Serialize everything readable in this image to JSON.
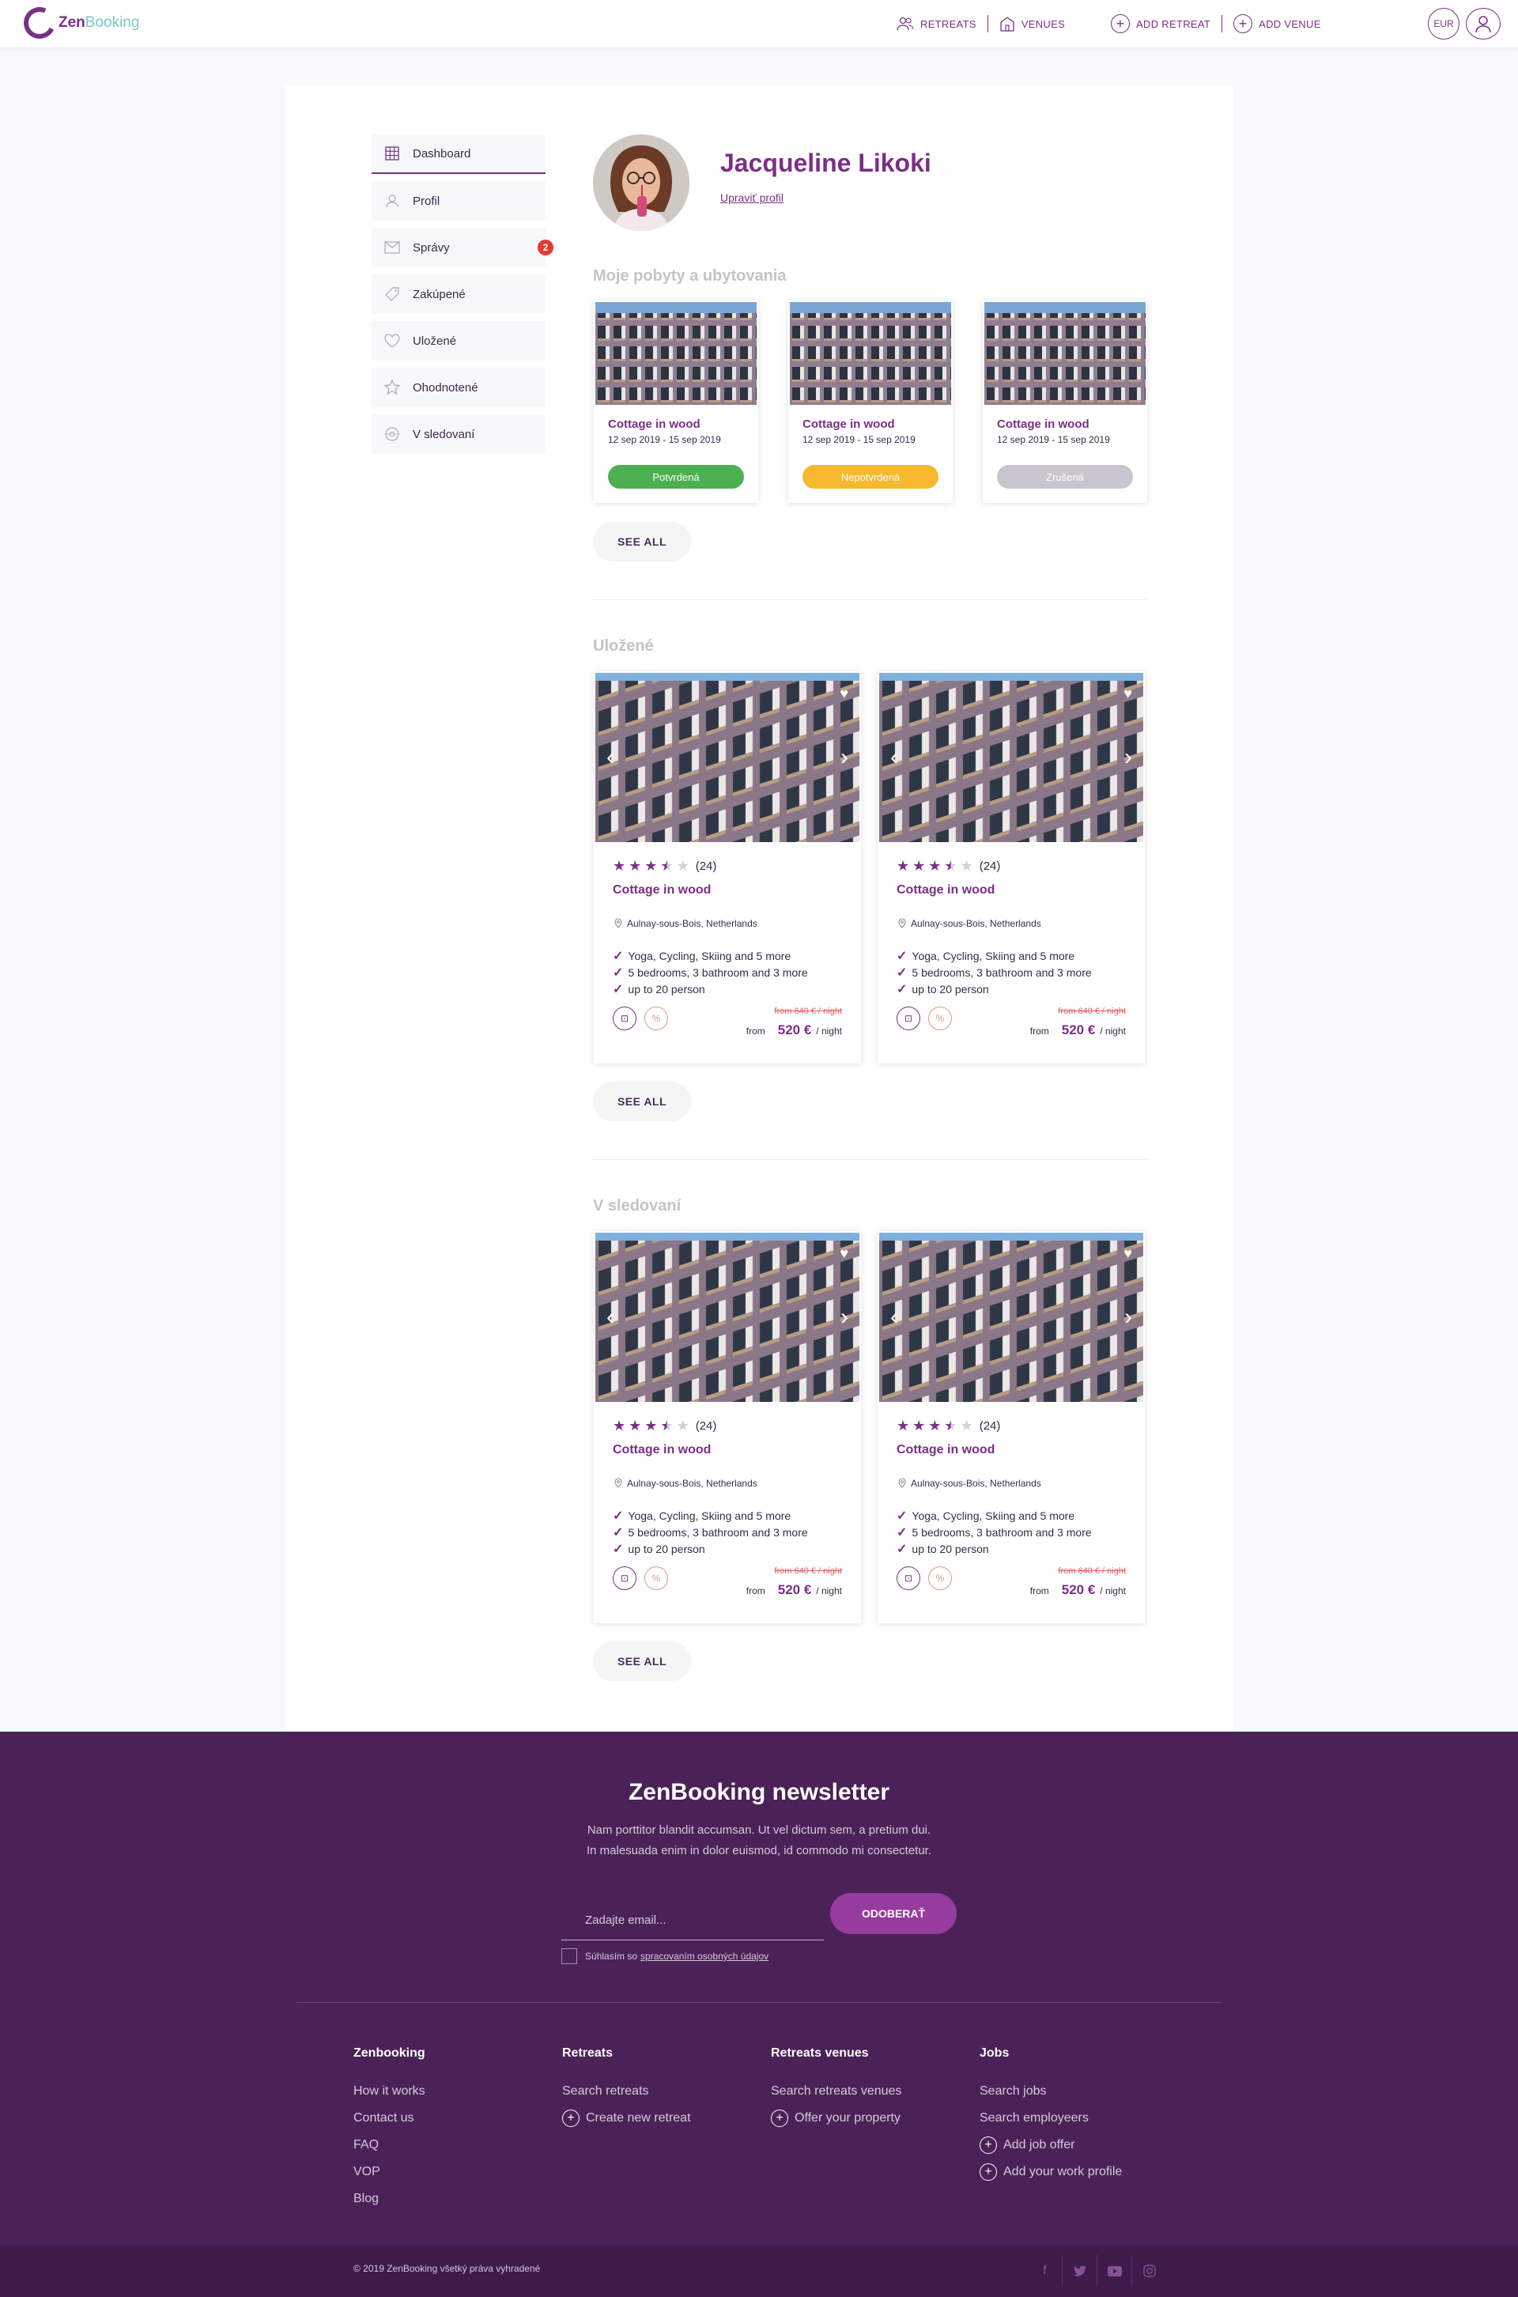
{
  "header": {
    "logo": {
      "part1": "Zen",
      "part2": "Booking"
    },
    "nav": {
      "retreats": "RETREATS",
      "venues": "VENUES",
      "add_retreat": "ADD RETREAT",
      "add_venue": "ADD VENUE"
    },
    "currency": "EUR"
  },
  "sidebar": {
    "items": [
      {
        "label": "Dashboard",
        "icon": "grid-icon"
      },
      {
        "label": "Profil",
        "icon": "user-icon"
      },
      {
        "label": "Správy",
        "icon": "envelope-icon",
        "badge": "2"
      },
      {
        "label": "Zakúpené",
        "icon": "tag-icon"
      },
      {
        "label": "Uložené",
        "icon": "heart-icon"
      },
      {
        "label": "Ohodnotené",
        "icon": "star-icon"
      },
      {
        "label": "V sledovaní",
        "icon": "eye-icon"
      }
    ]
  },
  "profile": {
    "name": "Jacqueline Likoki",
    "edit": "Upraviť profil"
  },
  "stays": {
    "title": "Moje pobyty a ubytovania",
    "cards": [
      {
        "name": "Cottage in wood",
        "dates": "12 sep 2019 - 15 sep 2019",
        "status": "Potvrdená",
        "status_color": "#4caf50"
      },
      {
        "name": "Cottage in wood",
        "dates": "12 sep 2019 - 15 sep 2019",
        "status": "Nepotvrdená",
        "status_color": "#f5b82e"
      },
      {
        "name": "Cottage in wood",
        "dates": "12 sep 2019 - 15 sep 2019",
        "status": "Zrušená",
        "status_color": "#c9c5cf"
      }
    ],
    "see_all": "SEE ALL"
  },
  "saved": {
    "title": "Uložené",
    "see_all": "SEE ALL",
    "cards": [
      {
        "rating": 3.5,
        "reviews": "(24)",
        "name": "Cottage in wood",
        "location": "Aulnay-sous-Bois, Netherlands",
        "features": [
          "Yoga, Cycling, Skiing and 5 more",
          "5 bedrooms, 3 bathroom and 3 more",
          "up to 20 person"
        ],
        "old_price": "from 640 € / night",
        "price_from": "from",
        "price": "520 €",
        "price_unit": "/ night"
      },
      {
        "rating": 3.5,
        "reviews": "(24)",
        "name": "Cottage in wood",
        "location": "Aulnay-sous-Bois, Netherlands",
        "features": [
          "Yoga, Cycling, Skiing and 5 more",
          "5 bedrooms, 3 bathroom and 3 more",
          "up to 20 person"
        ],
        "old_price": "from 640 € / night",
        "price_from": "from",
        "price": "520 €",
        "price_unit": "/ night"
      }
    ]
  },
  "following": {
    "title": "V sledovaní",
    "see_all": "SEE ALL",
    "cards": [
      {
        "rating": 3.5,
        "reviews": "(24)",
        "name": "Cottage in wood",
        "location": "Aulnay-sous-Bois, Netherlands",
        "features": [
          "Yoga, Cycling, Skiing and 5 more",
          "5 bedrooms, 3 bathroom and 3 more",
          "up to 20 person"
        ],
        "old_price": "from 640 € / night",
        "price_from": "from",
        "price": "520 €",
        "price_unit": "/ night"
      },
      {
        "rating": 3.5,
        "reviews": "(24)",
        "name": "Cottage in wood",
        "location": "Aulnay-sous-Bois, Netherlands",
        "features": [
          "Yoga, Cycling, Skiing and 5 more",
          "5 bedrooms, 3 bathroom and 3 more",
          "up to 20 person"
        ],
        "old_price": "from 640 € / night",
        "price_from": "from",
        "price": "520 €",
        "price_unit": "/ night"
      }
    ]
  },
  "newsletter": {
    "title": "ZenBooking newsletter",
    "text1": "Nam porttitor blandit accumsan. Ut vel dictum sem, a pretium dui.",
    "text2": "In malesuada enim in dolor euismod, id commodo mi consectetur.",
    "placeholder": "Zadajte email...",
    "button": "ODOBERAŤ",
    "consent_prefix": "Súhlasím so",
    "consent_link": "spracovaním osobných údajov"
  },
  "footer": {
    "columns": [
      {
        "title": "Zenbooking",
        "links": [
          {
            "label": "How it works"
          },
          {
            "label": "Contact us"
          },
          {
            "label": "FAQ"
          },
          {
            "label": "VOP"
          },
          {
            "label": "Blog"
          }
        ]
      },
      {
        "title": "Retreats",
        "links": [
          {
            "label": "Search retreats"
          },
          {
            "label": "Create new retreat",
            "plus": true
          }
        ]
      },
      {
        "title": "Retreats venues",
        "links": [
          {
            "label": "Search retreats venues"
          },
          {
            "label": "Offer your property",
            "plus": true
          }
        ]
      },
      {
        "title": "Jobs",
        "links": [
          {
            "label": "Search jobs"
          },
          {
            "label": "Search employeers"
          },
          {
            "label": "Add job offer",
            "plus": true
          },
          {
            "label": "Add your work profile",
            "plus": true
          }
        ]
      }
    ],
    "copyright": "© 2019 ZenBooking všetký práva vyhradené",
    "social": [
      "facebook-icon",
      "twitter-icon",
      "youtube-icon",
      "instagram-icon"
    ]
  }
}
